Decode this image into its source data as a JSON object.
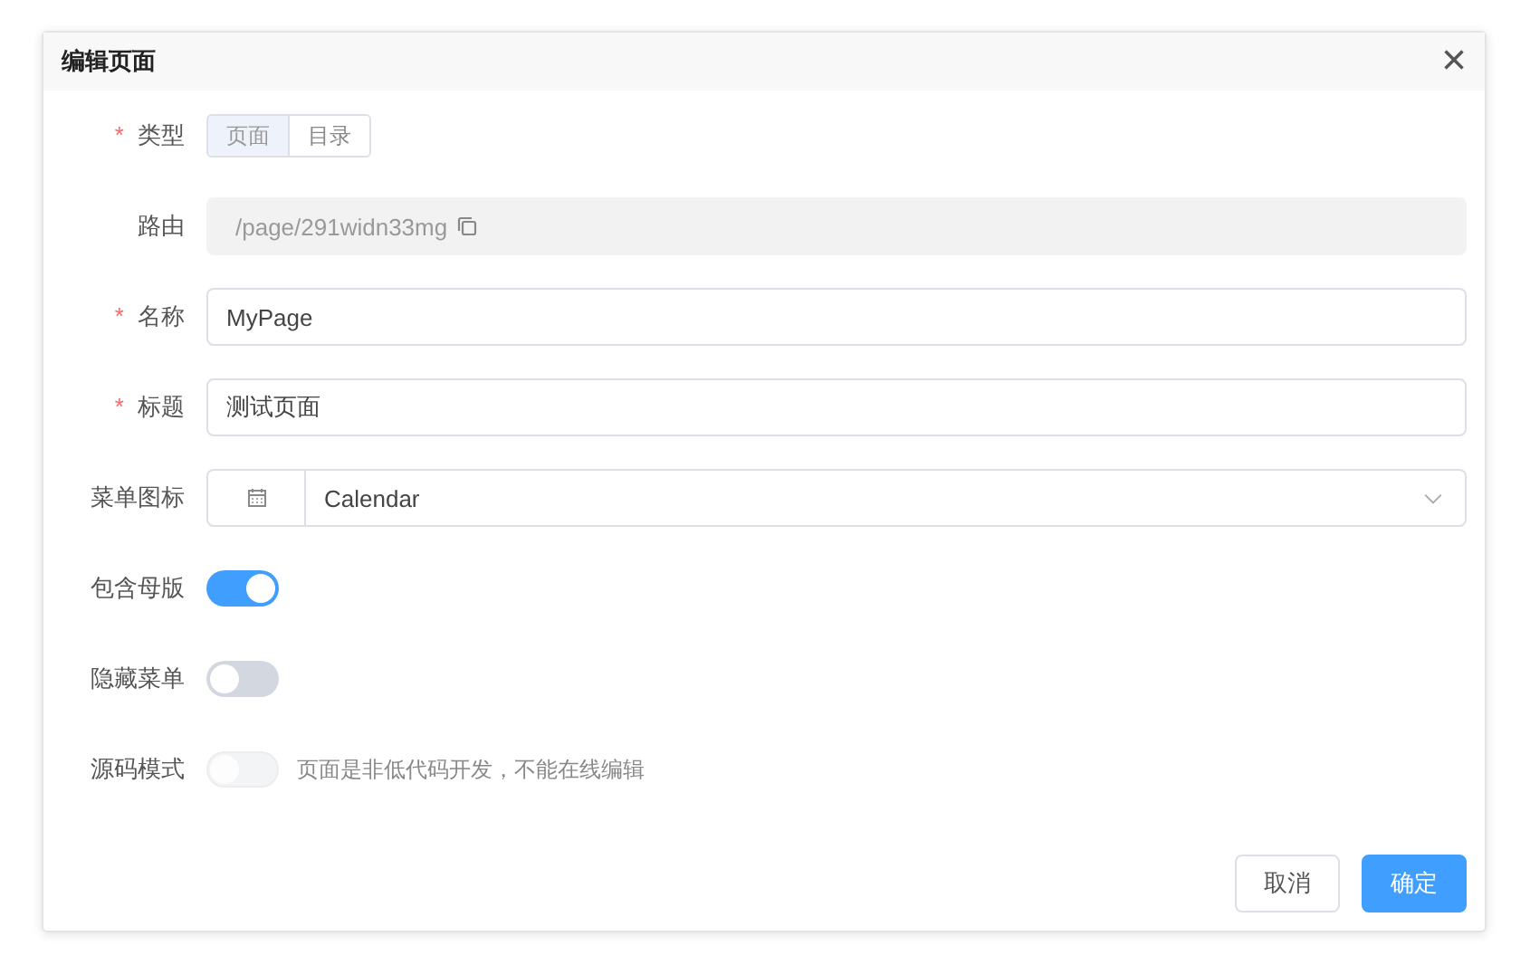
{
  "dialog": {
    "title": "编辑页面",
    "close": "×"
  },
  "fields": [
    {
      "kind": "segmented",
      "label": "类型",
      "mark": "*",
      "options": [
        {
          "label": "页面",
          "selected": true
        },
        {
          "label": "目录",
          "selected": false
        }
      ]
    },
    {
      "kind": "readonly",
      "label": "路由",
      "value": "/page/291widn33mg"
    },
    {
      "kind": "text",
      "label": "名称",
      "mark": "*",
      "value": "MyPage"
    },
    {
      "kind": "text",
      "label": "标题",
      "mark": "*",
      "value": "测试页面"
    },
    {
      "kind": "icon-select",
      "label": "菜单图标",
      "value": "Calendar"
    },
    {
      "kind": "switch",
      "label": "包含母版",
      "on": true,
      "disabled": false
    },
    {
      "kind": "switch",
      "label": "隐藏菜单",
      "on": false,
      "disabled": false
    },
    {
      "kind": "switch",
      "label": "源码模式",
      "on": false,
      "disabled": true,
      "hint": "页面是非低代码开发，不能在线编辑"
    }
  ],
  "buttons": [
    {
      "label": "取消",
      "kind": "default"
    },
    {
      "label": "确定",
      "kind": "primary"
    }
  ]
}
